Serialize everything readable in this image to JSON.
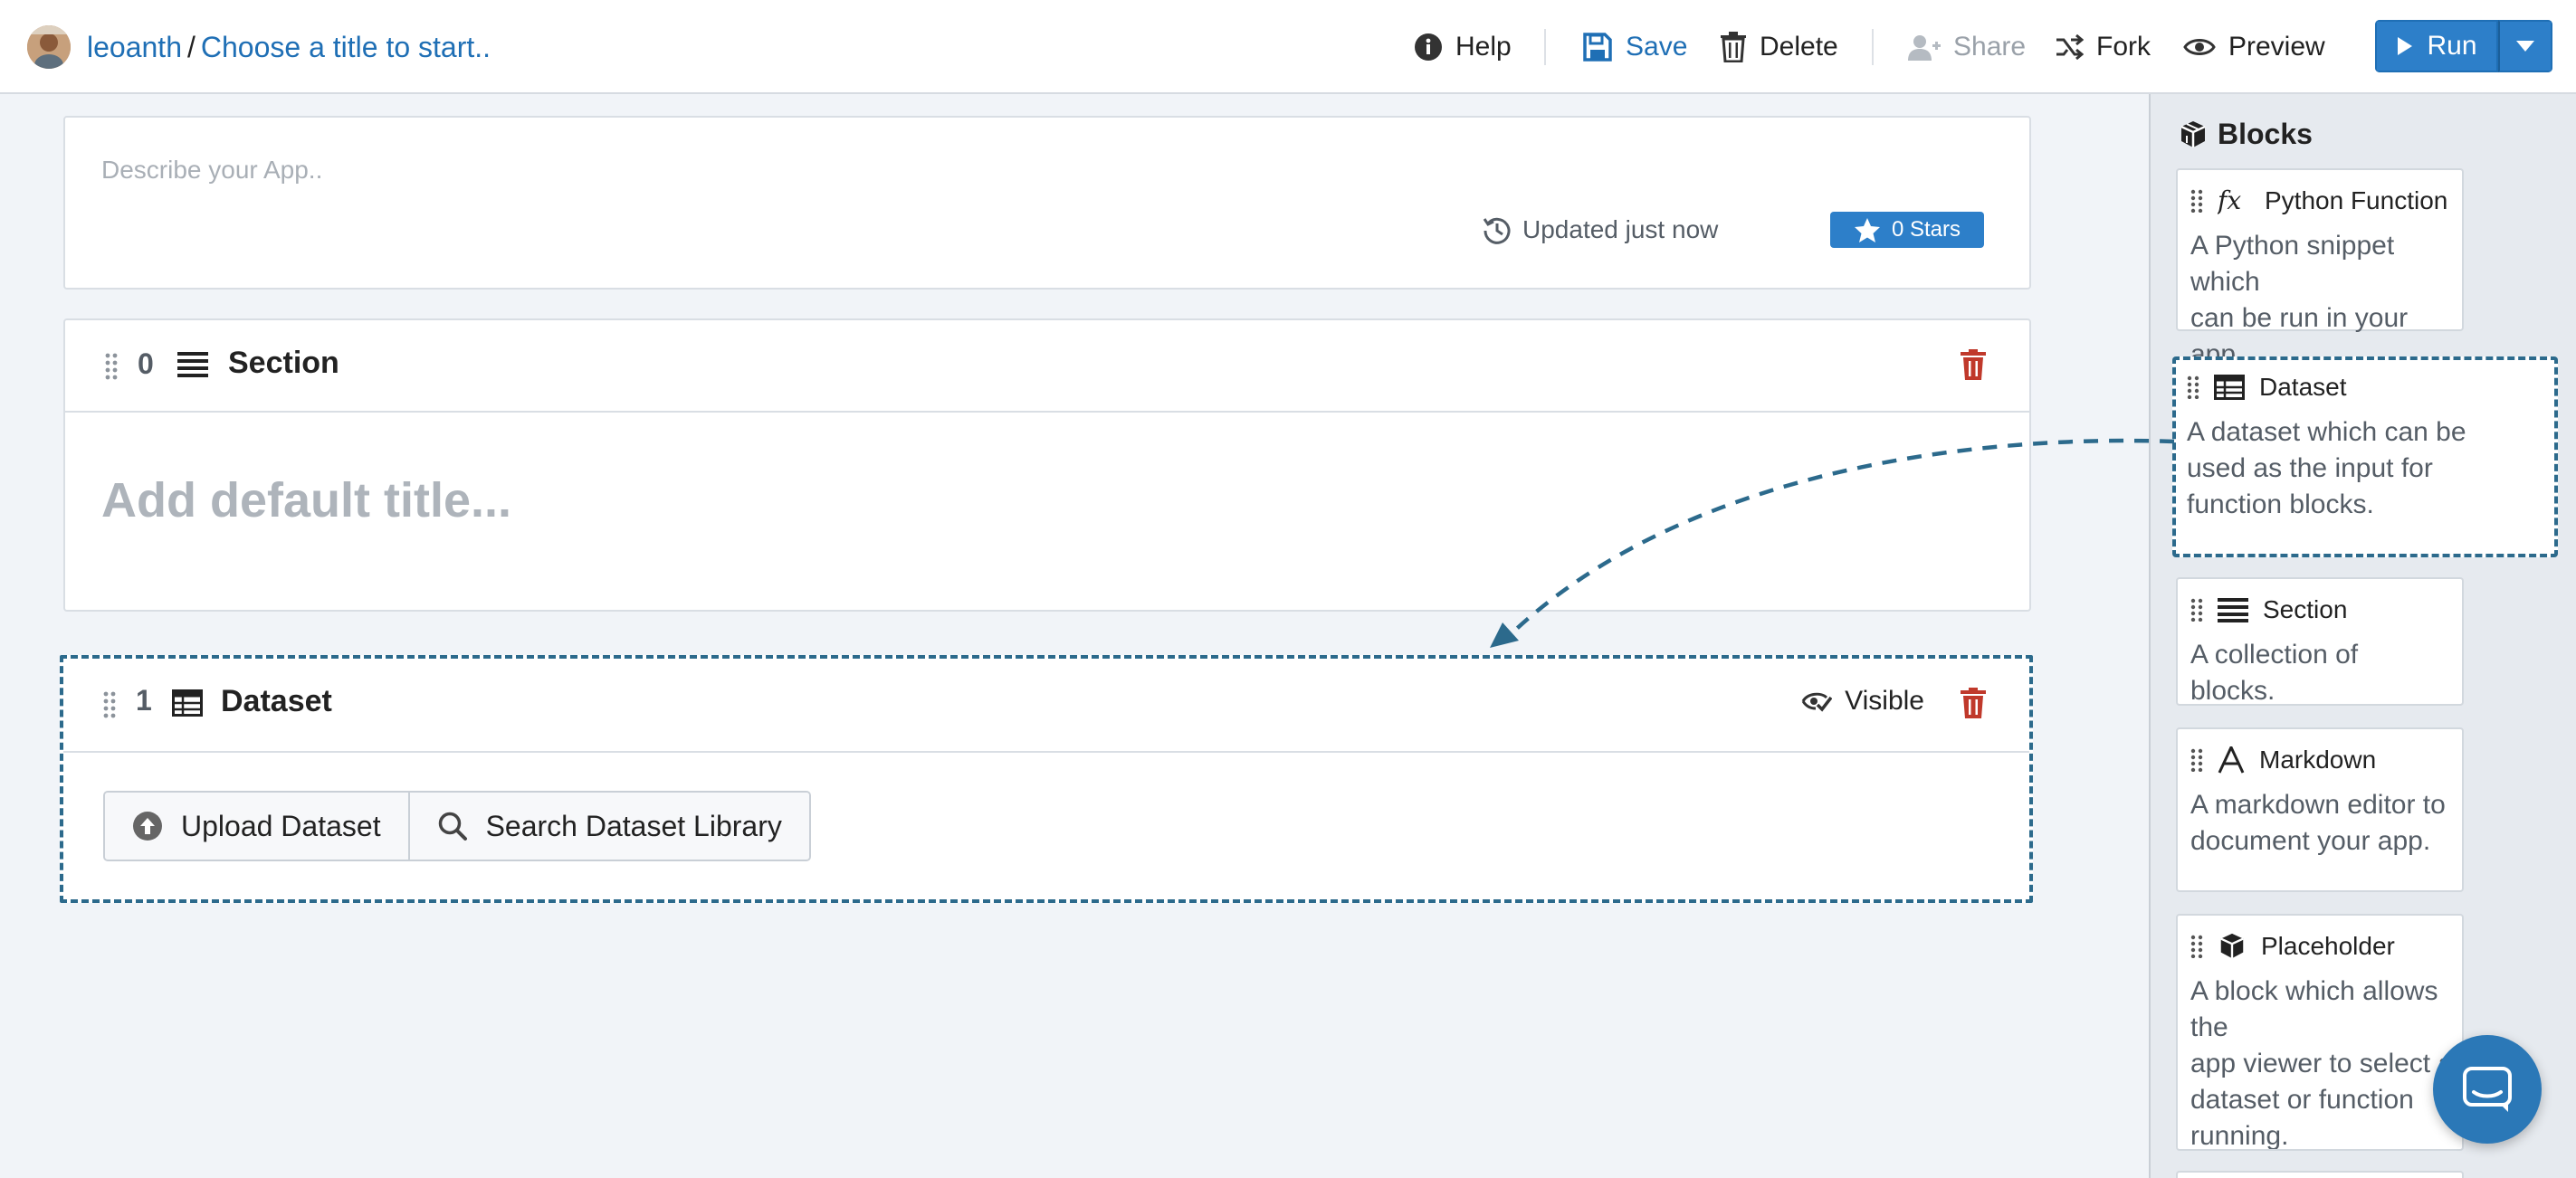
{
  "header": {
    "user": "leoanth",
    "separator": "/",
    "title_placeholder": "Choose a title to start..",
    "help": "Help",
    "save": "Save",
    "delete": "Delete",
    "share": "Share",
    "fork": "Fork",
    "preview": "Preview",
    "run": "Run"
  },
  "app": {
    "description_placeholder": "Describe your App..",
    "updated": "Updated just now",
    "stars": "0 Stars"
  },
  "blocks": [
    {
      "index": "0",
      "title": "Section",
      "default_title": "Add default title..."
    },
    {
      "index": "1",
      "title": "Dataset",
      "visibility": "Visible",
      "upload": "Upload Dataset",
      "search": "Search Dataset Library"
    }
  ],
  "sidebar": {
    "title": "Blocks",
    "items": [
      {
        "name": "Python Function",
        "icon": "function-icon",
        "desc_lines": [
          "A Python snippet which",
          "can be run in your app."
        ]
      },
      {
        "name": "Dataset",
        "icon": "table-icon",
        "desc_lines": [
          "A dataset which can be",
          "used as the input for",
          "function blocks."
        ]
      },
      {
        "name": "Section",
        "icon": "list-icon",
        "desc_lines": [
          "A collection of blocks."
        ]
      },
      {
        "name": "Markdown",
        "icon": "font-icon",
        "desc_lines": [
          "A markdown editor to",
          "document your app."
        ]
      },
      {
        "name": "Placeholder",
        "icon": "cubes-icon",
        "desc_lines": [
          "A block which allows the",
          "app viewer to select a",
          "dataset or function",
          "running."
        ]
      }
    ]
  },
  "colors": {
    "accent": "#2d7fc9",
    "link": "#1f6fb5",
    "danger": "#c0392b",
    "dashed_highlight": "#2c6a8c"
  }
}
